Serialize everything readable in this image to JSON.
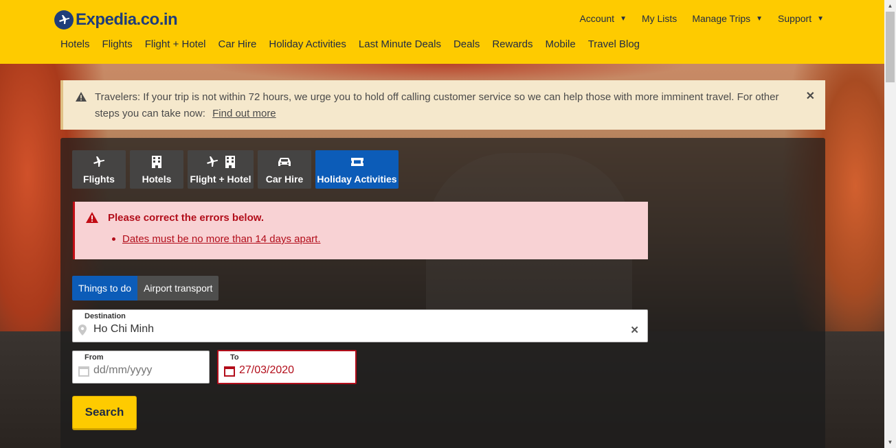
{
  "header": {
    "logo_text": "Expedia.co.in",
    "util_nav": [
      {
        "label": "Account",
        "dropdown": true
      },
      {
        "label": "My Lists",
        "dropdown": false
      },
      {
        "label": "Manage Trips",
        "dropdown": true
      },
      {
        "label": "Support",
        "dropdown": true
      }
    ],
    "main_nav": [
      "Hotels",
      "Flights",
      "Flight + Hotel",
      "Car Hire",
      "Holiday Activities",
      "Last Minute Deals",
      "Deals",
      "Rewards",
      "Mobile",
      "Travel Blog"
    ]
  },
  "notice": {
    "text": "Travelers: If your trip is not within 72 hours, we urge you to hold off calling customer service so we can help those with more imminent travel. For other steps you can take now:",
    "link": "Find out more",
    "icon": "warning-icon"
  },
  "search": {
    "tabs": [
      {
        "label": "Flights",
        "icons": [
          "plane-icon"
        ],
        "active": false
      },
      {
        "label": "Hotels",
        "icons": [
          "building-icon"
        ],
        "active": false
      },
      {
        "label": "Flight + Hotel",
        "icons": [
          "plane-icon",
          "building-icon"
        ],
        "active": false
      },
      {
        "label": "Car Hire",
        "icons": [
          "car-icon"
        ],
        "active": false
      },
      {
        "label": "Holiday Activities",
        "icons": [
          "ticket-icon"
        ],
        "active": true
      }
    ],
    "error": {
      "title": "Please correct the errors below.",
      "items": [
        "Dates must be no more than 14 days apart."
      ]
    },
    "subtabs": [
      {
        "label": "Things to do",
        "active": true
      },
      {
        "label": "Airport transport",
        "active": false
      }
    ],
    "destination": {
      "label": "Destination",
      "value": "Ho Chi Minh"
    },
    "from": {
      "label": "From",
      "placeholder": "dd/mm/yyyy",
      "value": ""
    },
    "to": {
      "label": "To",
      "value": "27/03/2020"
    },
    "search_label": "Search"
  },
  "colors": {
    "brand_yellow": "#fecb00",
    "brand_blue": "#1f3d7a",
    "active_tab": "#0c5cb8",
    "error_red": "#b20d1a",
    "error_bg": "#f8d2d4",
    "notice_bg": "#f5e8cc"
  }
}
